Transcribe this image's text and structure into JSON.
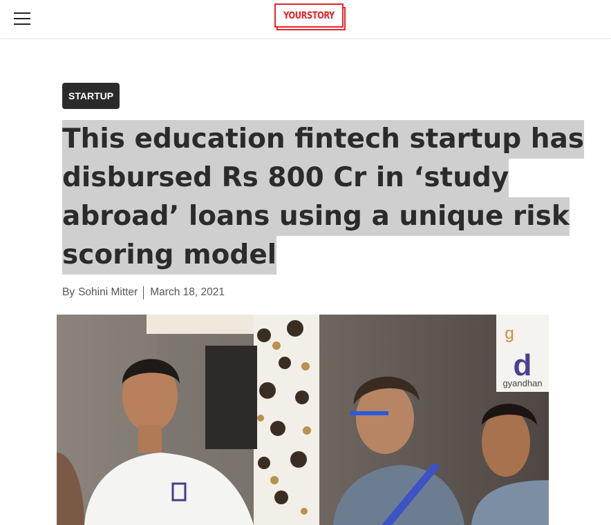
{
  "header": {
    "logo_text": "YOURSTORY",
    "menu_icon": "hamburger-menu-icon",
    "brand_color": "#e4252a"
  },
  "article": {
    "category": "STARTUP",
    "title_lines": [
      "This education fintech startup has",
      "disbursed Rs 800 Cr in ‘study",
      "abroad’ loans using a unique risk",
      "scoring model"
    ],
    "byline_prefix": "By",
    "author": "Sohini Mitter",
    "date": "March 18, 2021",
    "image_logo_text": "gyandhan"
  }
}
